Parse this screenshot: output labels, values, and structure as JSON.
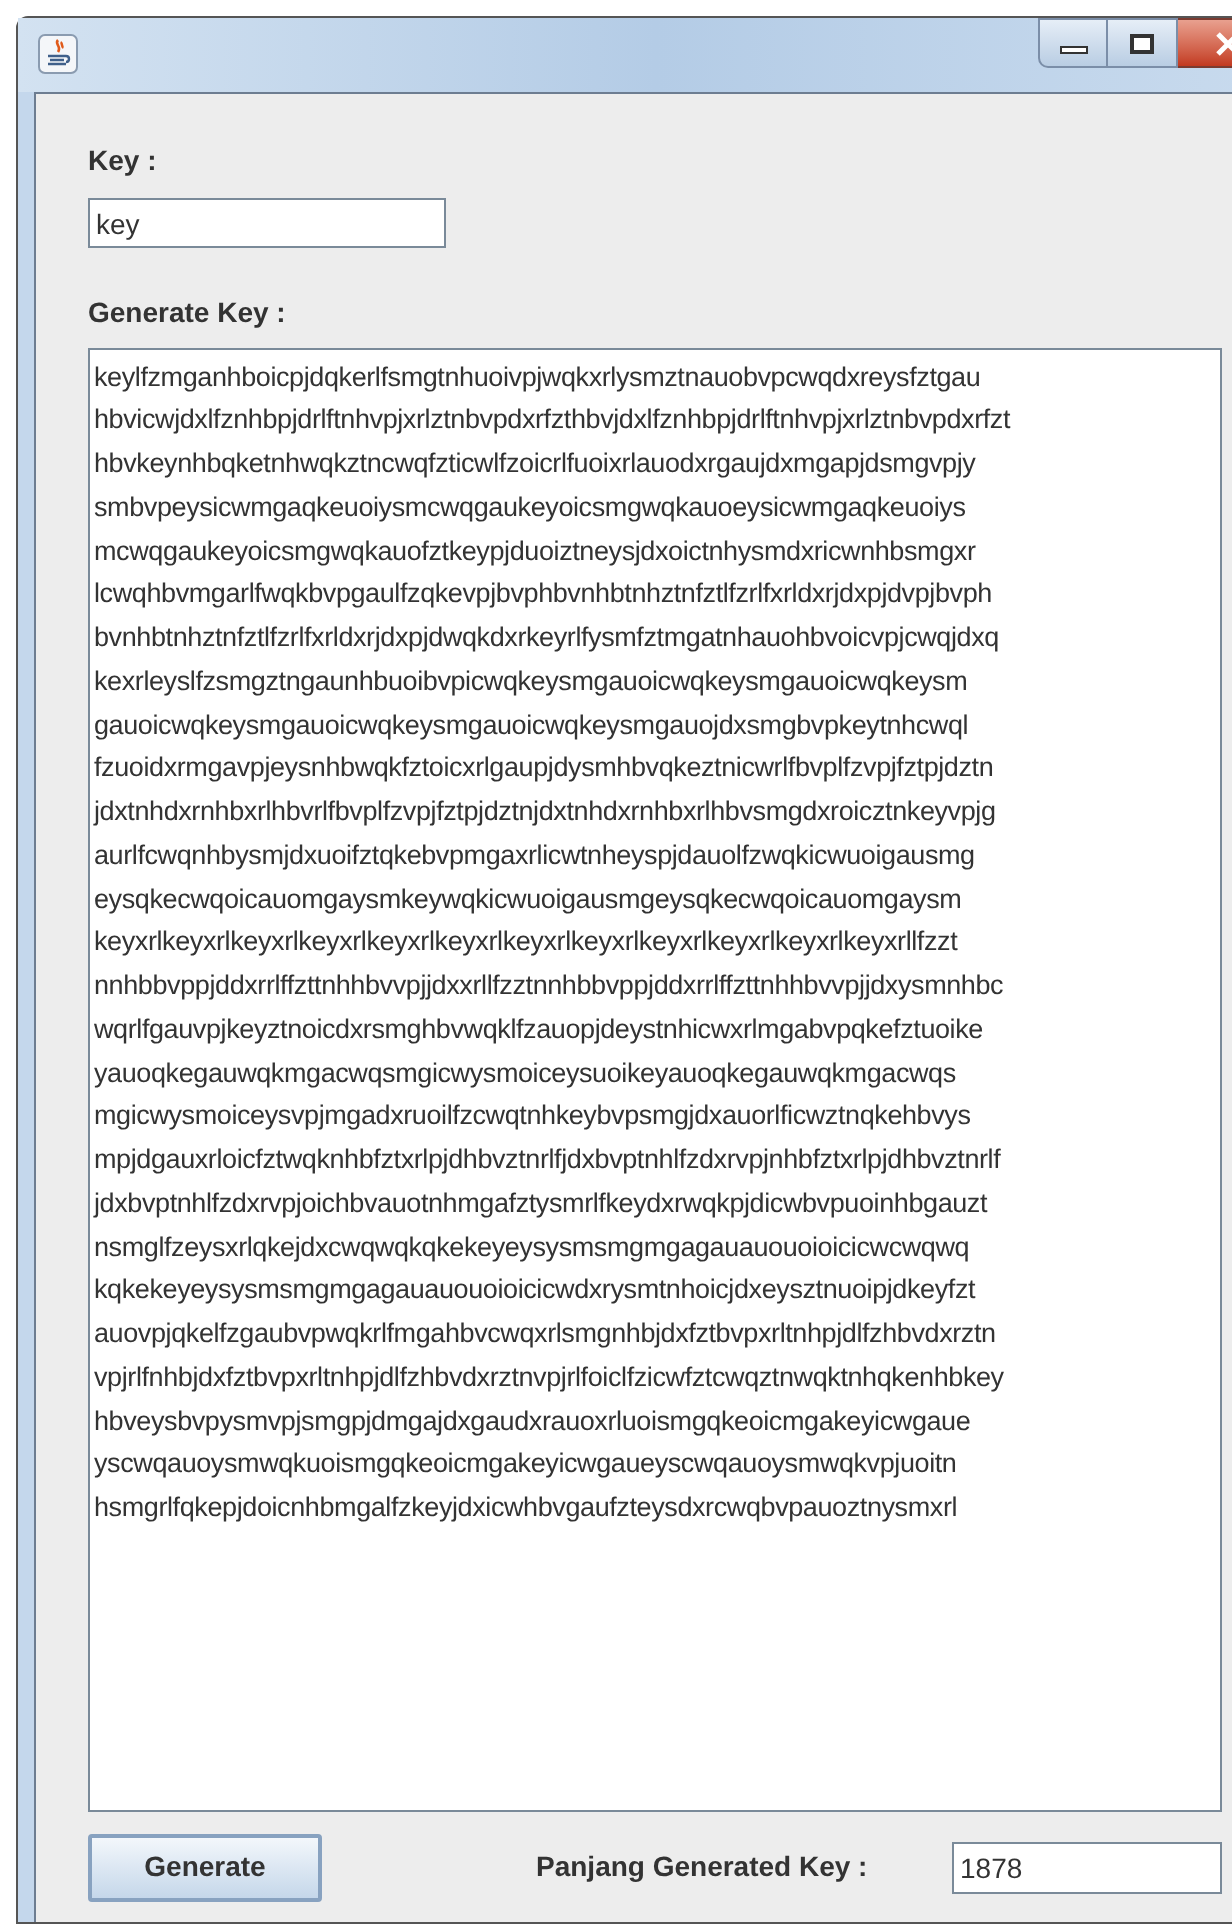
{
  "key": {
    "label": "Key :",
    "value": "key"
  },
  "generated_key": {
    "label": "Generate Key :",
    "lines": [
      "keylfzmganhboicpjdqkerlfsmgtnhuoivpjwqkxrlysmztnauobvpcwqdxreysfztgau",
      "hbvicwjdxlfznhbpjdrlftnhvpjxrlztnbvpdxrfzthbvjdxlfznhbpjdrlftnhvpjxrlztnbvpdxrfzt",
      "hbvkeynhbqketnhwqkztncwqfzticwlfzoicrlfuoixrlauodxrgaujdxmgapjdsmgvpjy",
      "smbvpeysicwmgaqkeuoiysmcwqgaukeyoicsmgwqkauoeysicwmgaqkeuoiys",
      "mcwqgaukeyoicsmgwqkauofztkeypjduoiztneysjdxoictnhysmdxricwnhbsmgxr",
      "lcwqhbvmgarlfwqkbvpgaulfzqkevpjbvphbvnhbtnhztnfztlfzrlfxrldxrjdxpjdvpjbvph",
      "bvnhbtnhztnfztlfzrlfxrldxrjdxpjdwqkdxrkeyrlfysmfztmgatnhauohbvoicvpjcwqjdxq",
      "kexrleyslfzsmgztngaunhbuoibvpicwqkeysmgauoicwqkeysmgauoicwqkeysm",
      "gauoicwqkeysmgauoicwqkeysmgauoicwqkeysmgauojdxsmgbvpkeytnhcwql",
      "fzuoidxrmgavpjeysnhbwqkfztoicxrlgaupjdysmhbvqkeztnicwrlfbvplfzvpjfztpjdztn",
      "jdxtnhdxrnhbxrlhbvrlfbvplfzvpjfztpjdztnjdxtnhdxrnhbxrlhbvsmgdxroicztnkeyvpjg",
      "aurlfcwqnhbysmjdxuoifztqkebvpmgaxrlicwtnheyspjdauolfzwqkicwuoigausmg",
      "eysqkecwqoicauomgaysmkeywqkicwuoigausmgeysqkecwqoicauomgaysm",
      "keyxrlkeyxrlkeyxrlkeyxrlkeyxrlkeyxrlkeyxrlkeyxrlkeyxrlkeyxrlkeyxrlkeyxrllfzzt",
      "nnhbbvppjddxrrlffzttnhhbvvpjjdxxrllfzztnnhbbvppjddxrrlffzttnhhbvvpjjdxysmnhbc",
      "wqrlfgauvpjkeyztnoicdxrsmghbvwqklfzauopjdeystnhicwxrlmgabvpqkefztuoike",
      "yauoqkegauwqkmgacwqsmgicwysmoiceysuoikeyauoqkegauwqkmgacwqs",
      "mgicwysmoiceysvpjmgadxruoilfzcwqtnhkeybvpsmgjdxauorlficwztnqkehbvys",
      "mpjdgauxrloicfztwqknhbfztxrlpjdhbvztnrlfjdxbvptnhlfzdxrvpjnhbfztxrlpjdhbvztnrlf",
      "jdxbvptnhlfzdxrvpjoichbvauotnhmgafztysmrlfkeydxrwqkpjdicwbvpuoinhbgauzt",
      "nsmglfzeysxrlqkejdxcwqwqkqkekeyeysysmsmgmgagauauouoioicicwcwqwq",
      "kqkekeyeysysmsmgmgagauauouoioicicwdxrysmtnhoicjdxeysztnuoipjdkeyfzt",
      "auovpjqkelfzgaubvpwqkrlfmgahbvcwqxrlsmgnhbjdxfztbvpxrltnhpjdlfzhbvdxrztn",
      "vpjrlfnhbjdxfztbvpxrltnhpjdlfzhbvdxrztnvpjrlfoiclfzicwfztcwqztnwqktnhqkenhbkey",
      "hbveysbvpysmvpjsmgpjdmgajdxgaudxrauoxrluoismgqkeoicmgakeyicwgaue",
      "yscwqauoysmwqkuoismgqkeoicmgakeyicwgaueyscwqauoysmwqkvpjuoitn",
      "hsmgrlfqkepjdoicnhbmgalfzkeyjdxicwhbvgaufzteysdxrcwqbvpauoztnysmxrl"
    ]
  },
  "generate_button": "Generate",
  "length": {
    "label": "Panjang Generated Key :",
    "value": "1878"
  }
}
